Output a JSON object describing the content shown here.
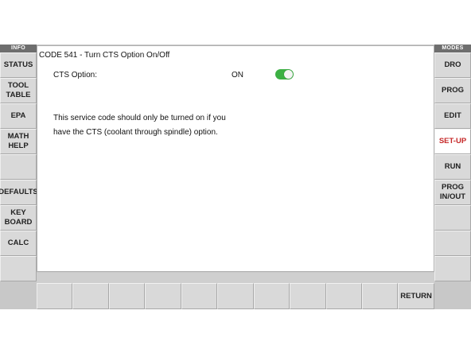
{
  "info_panel": {
    "header": "INFO",
    "buttons": [
      "STATUS",
      "TOOL\nTABLE",
      "EPA",
      "MATH\nHELP",
      "",
      "DEFAULTS",
      "KEY\nBOARD",
      "CALC",
      ""
    ]
  },
  "modes_panel": {
    "header": "MODES",
    "buttons": [
      "DRO",
      "PROG",
      "EDIT",
      "SET-UP",
      "RUN",
      "PROG\nIN/OUT",
      "",
      "",
      ""
    ],
    "active": "SET-UP",
    "active_color": "#c62828"
  },
  "main": {
    "title": "CODE 541 - Turn CTS Option On/Off",
    "option_label": "CTS Option:",
    "option_value": "ON",
    "toggle_on": true,
    "toggle_color": "#3cb043",
    "description": "This service code should only be turned on if you have the CTS (coolant through spindle) option."
  },
  "bottom_bar": {
    "buttons": [
      "",
      "",
      "",
      "",
      "",
      "",
      "",
      "",
      "",
      "",
      "RETURN"
    ]
  }
}
